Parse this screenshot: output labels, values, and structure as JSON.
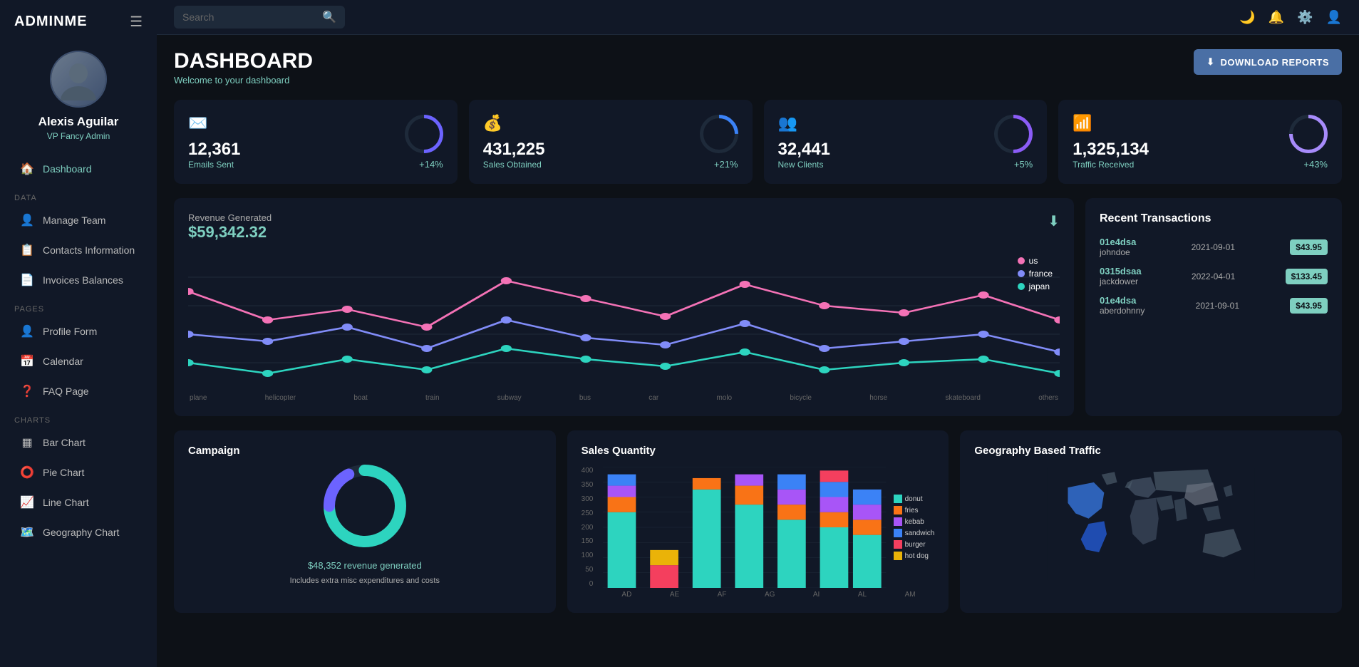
{
  "sidebar": {
    "logo": "ADMINME",
    "profile": {
      "name": "Alexis Aguilar",
      "title": "VP Fancy Admin"
    },
    "sections": [
      {
        "label": "",
        "items": [
          {
            "id": "dashboard",
            "label": "Dashboard",
            "icon": "🏠",
            "active": true
          }
        ]
      },
      {
        "label": "Data",
        "items": [
          {
            "id": "manage-team",
            "label": "Manage Team",
            "icon": "👤"
          },
          {
            "id": "contacts",
            "label": "Contacts Information",
            "icon": "📋"
          },
          {
            "id": "invoices",
            "label": "Invoices Balances",
            "icon": "📄"
          }
        ]
      },
      {
        "label": "Pages",
        "items": [
          {
            "id": "profile-form",
            "label": "Profile Form",
            "icon": "👤"
          },
          {
            "id": "calendar",
            "label": "Calendar",
            "icon": "📅"
          },
          {
            "id": "faq",
            "label": "FAQ Page",
            "icon": "❓"
          }
        ]
      },
      {
        "label": "Charts",
        "items": [
          {
            "id": "bar-chart",
            "label": "Bar Chart",
            "icon": "📊"
          },
          {
            "id": "pie-chart",
            "label": "Pie Chart",
            "icon": "⭕"
          },
          {
            "id": "line-chart",
            "label": "Line Chart",
            "icon": "📈"
          },
          {
            "id": "geography-chart",
            "label": "Geography Chart",
            "icon": "🗺️"
          }
        ]
      }
    ]
  },
  "topbar": {
    "search_placeholder": "Search"
  },
  "dashboard": {
    "title": "DASHBOARD",
    "subtitle": "Welcome to your dashboard",
    "download_btn": "DOWNLOAD REPORTS"
  },
  "stats": [
    {
      "icon": "✉️",
      "value": "12,361",
      "label": "Emails Sent",
      "pct": "+14%"
    },
    {
      "icon": "💰",
      "value": "431,225",
      "label": "Sales Obtained",
      "pct": "+21%"
    },
    {
      "icon": "👥",
      "value": "32,441",
      "label": "New Clients",
      "pct": "+5%"
    },
    {
      "icon": "📶",
      "value": "1,325,134",
      "label": "Traffic Received",
      "pct": "+43%"
    }
  ],
  "revenue": {
    "title": "Revenue Generated",
    "amount": "$59,342.32"
  },
  "transactions": {
    "title": "Recent Transactions",
    "items": [
      {
        "id": "01e4dsa",
        "user": "johndoe",
        "date": "2021-09-01",
        "amount": "$43.95"
      },
      {
        "id": "0315dsaa",
        "user": "jackdower",
        "date": "2022-04-01",
        "amount": "$133.45"
      },
      {
        "id": "01e4dsa",
        "user": "aberdohnny",
        "date": "2021-09-01",
        "amount": "$43.95"
      }
    ]
  },
  "campaign": {
    "title": "Campaign",
    "revenue": "$48,352 revenue generated",
    "note": "Includes extra misc expenditures and costs"
  },
  "sales_quantity": {
    "title": "Sales Quantity",
    "legend": [
      "donut",
      "fries",
      "kebab",
      "sandwich",
      "burger",
      "hot dog"
    ],
    "legend_colors": [
      "#2dd4bf",
      "#f97316",
      "#a855f7",
      "#3b82f6",
      "#f43f5e",
      "#eab308"
    ],
    "x_labels": [
      "AD",
      "AE",
      "AF",
      "AG",
      "AI",
      "AL",
      "AM"
    ],
    "y_labels": [
      "400",
      "350",
      "300",
      "250",
      "200",
      "150",
      "100",
      "50",
      "0"
    ]
  },
  "geography": {
    "title": "Geography Based Traffic"
  }
}
